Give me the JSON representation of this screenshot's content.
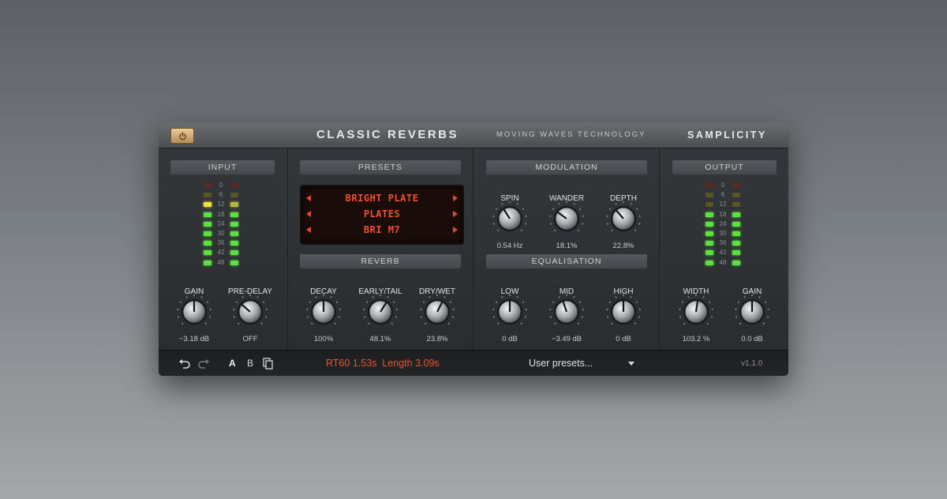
{
  "header": {
    "product": "CLASSIC REVERBS",
    "tech": "MOVING WAVES TECHNOLOGY",
    "brand": "SAMPLICITY",
    "power_icon": "power-icon",
    "power_color": "#d9b57a"
  },
  "input": {
    "title": "INPUT",
    "scale": [
      "0",
      "6",
      "12",
      "18",
      "24",
      "30",
      "36",
      "42",
      "48"
    ],
    "knobs": [
      {
        "label": "GAIN",
        "value": "−3.18 dB",
        "level": 0.5
      },
      {
        "label": "PRE-DELAY",
        "value": "OFF",
        "level": 0.32
      }
    ],
    "lit": 7
  },
  "presets": {
    "title": "PRESETS",
    "rows": [
      "BRIGHT PLATE",
      "PLATES",
      "BRI M7"
    ],
    "text_color": "#f0502a"
  },
  "reverb": {
    "title": "REVERB",
    "knobs": [
      {
        "label": "DECAY",
        "value": "100%",
        "level": 0.5
      },
      {
        "label": "EARLY/TAIL",
        "value": "48.1%",
        "level": 0.62
      },
      {
        "label": "DRY/WET",
        "value": "23.8%",
        "level": 0.6
      }
    ]
  },
  "modulation": {
    "title": "MODULATION",
    "knobs": [
      {
        "label": "SPIN",
        "value": "0.54 Hz",
        "level": 0.38
      },
      {
        "label": "WANDER",
        "value": "18.1%",
        "level": 0.3
      },
      {
        "label": "DEPTH",
        "value": "22.8%",
        "level": 0.35
      }
    ]
  },
  "equalisation": {
    "title": "EQUALISATION",
    "knobs": [
      {
        "label": "LOW",
        "value": "0 dB",
        "level": 0.5
      },
      {
        "label": "MID",
        "value": "−3.49 dB",
        "level": 0.43
      },
      {
        "label": "HIGH",
        "value": "0 dB",
        "level": 0.5
      }
    ]
  },
  "output": {
    "title": "OUTPUT",
    "scale": [
      "0",
      "6",
      "12",
      "18",
      "24",
      "30",
      "36",
      "42",
      "48"
    ],
    "knobs": [
      {
        "label": "WIDTH",
        "value": "103.2 %",
        "level": 0.53
      },
      {
        "label": "GAIN",
        "value": "0.0 dB",
        "level": 0.5
      }
    ],
    "lit": 6
  },
  "bottom": {
    "undo_icon": "undo-icon",
    "redo_icon": "redo-icon",
    "a_label": "A",
    "b_label": "B",
    "copy_icon": "copy-icon",
    "rt60": "RT60 1.53s",
    "length": "Length 3.09s",
    "user_presets": "User presets...",
    "version": "v1.1.0",
    "accent": "#e8552f"
  }
}
